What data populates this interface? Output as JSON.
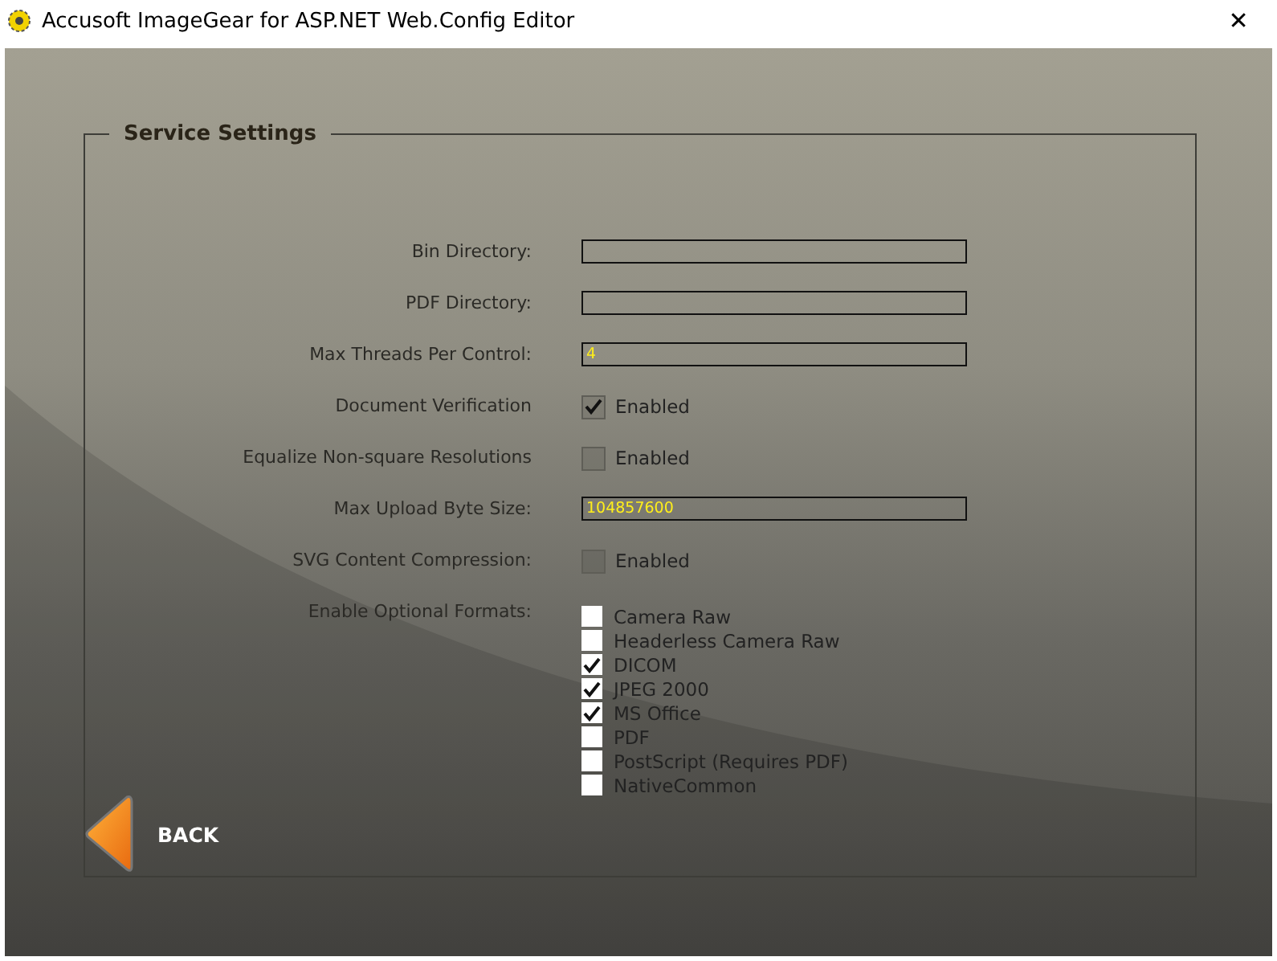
{
  "window": {
    "title": "Accusoft ImageGear for ASP.NET Web.Config Editor",
    "close": "✕"
  },
  "group": {
    "title": "Service Settings"
  },
  "settings": [
    {
      "kind": "text",
      "label": "Bin Directory:"
    },
    {
      "kind": "text",
      "label": "PDF Directory:"
    },
    {
      "kind": "text",
      "label": "Max Threads Per Control:",
      "value": "4"
    },
    {
      "kind": "toggle",
      "label": "Document Verification",
      "option": "Enabled",
      "checked": true
    },
    {
      "kind": "toggle",
      "label": "Equalize Non-square Resolutions",
      "option": "Enabled",
      "checked": false
    },
    {
      "kind": "text",
      "label": "Max Upload Byte Size:",
      "value": "104857600"
    },
    {
      "kind": "toggle",
      "label": "SVG Content Compression:",
      "option": "Enabled",
      "checked": false
    },
    {
      "kind": "checklist",
      "label": "Enable Optional Formats:",
      "items": [
        {
          "label": "Camera Raw",
          "checked": false
        },
        {
          "label": "Headerless Camera Raw",
          "checked": false
        },
        {
          "label": "DICOM",
          "checked": true
        },
        {
          "label": "JPEG 2000",
          "checked": true
        },
        {
          "label": "MS Office",
          "checked": true
        },
        {
          "label": "PDF",
          "checked": false
        },
        {
          "label": "PostScript (Requires PDF)",
          "checked": false
        },
        {
          "label": "NativeCommon",
          "checked": false
        }
      ]
    }
  ],
  "back_button": {
    "label": "BACK"
  }
}
